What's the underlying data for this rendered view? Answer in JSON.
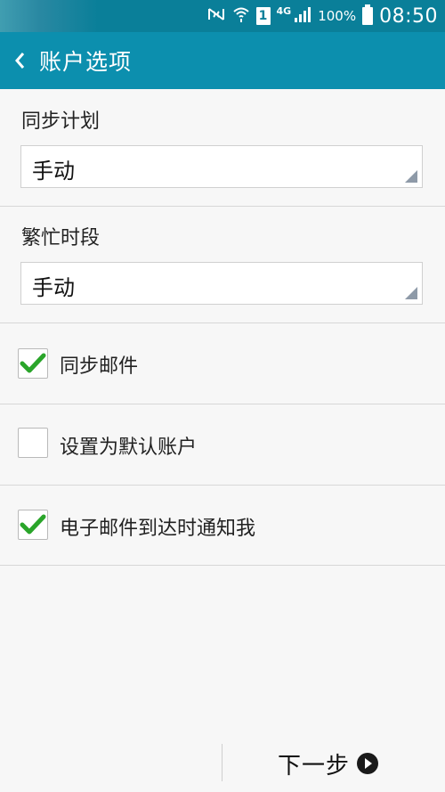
{
  "status_bar": {
    "battery_pct": "100%",
    "time": "08:50",
    "network": "4G",
    "sim_slot": "1"
  },
  "app_bar": {
    "title": "账户选项"
  },
  "sync_schedule": {
    "label": "同步计划",
    "value": "手动"
  },
  "peak_schedule": {
    "label": "繁忙时段",
    "value": "手动"
  },
  "checkboxes": [
    {
      "label": "同步邮件",
      "checked": true
    },
    {
      "label": "设置为默认账户",
      "checked": false
    },
    {
      "label": "电子邮件到达时通知我",
      "checked": true
    }
  ],
  "footer": {
    "next_label": "下一步"
  },
  "colors": {
    "status_bar": "#0a7f99",
    "app_bar": "#0c8fae",
    "check": "#2aa52a",
    "background": "#f7f7f7"
  }
}
